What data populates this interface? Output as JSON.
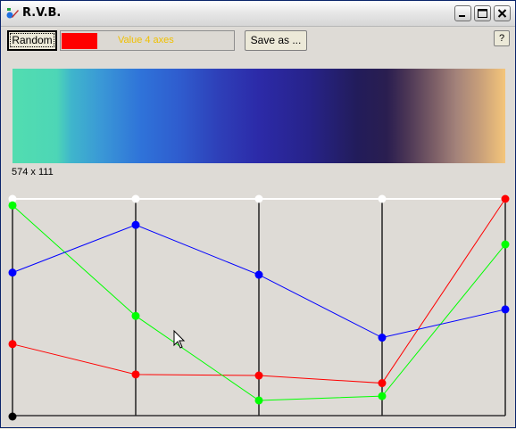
{
  "window": {
    "title": "R.V.B.",
    "controls": {
      "minimize": "minimize-icon",
      "maximize": "maximize-icon",
      "close": "close-icon"
    }
  },
  "toolbar": {
    "random_label": "Random",
    "swatch_color": "#FF0000",
    "swatch_label": "Value 4 axes",
    "save_label": "Save as ...",
    "help_label": "?"
  },
  "gradient": {
    "size_label": "574 x 111"
  },
  "curves": {
    "axes_count": 5,
    "y_scale": [
      0,
      1
    ],
    "top_markers": [
      1,
      1,
      1,
      1,
      1
    ],
    "series": [
      {
        "color": "#FF0000",
        "values": [
          0.33,
          0.19,
          0.185,
          0.15,
          1.0
        ]
      },
      {
        "color": "#00FF00",
        "values": [
          0.97,
          0.46,
          0.07,
          0.09,
          0.79
        ]
      },
      {
        "color": "#0000FF",
        "values": [
          0.66,
          0.88,
          0.65,
          0.36,
          0.49
        ]
      }
    ],
    "origin_marker_color": "#000000",
    "top_marker_color": "#FFFFFF"
  }
}
